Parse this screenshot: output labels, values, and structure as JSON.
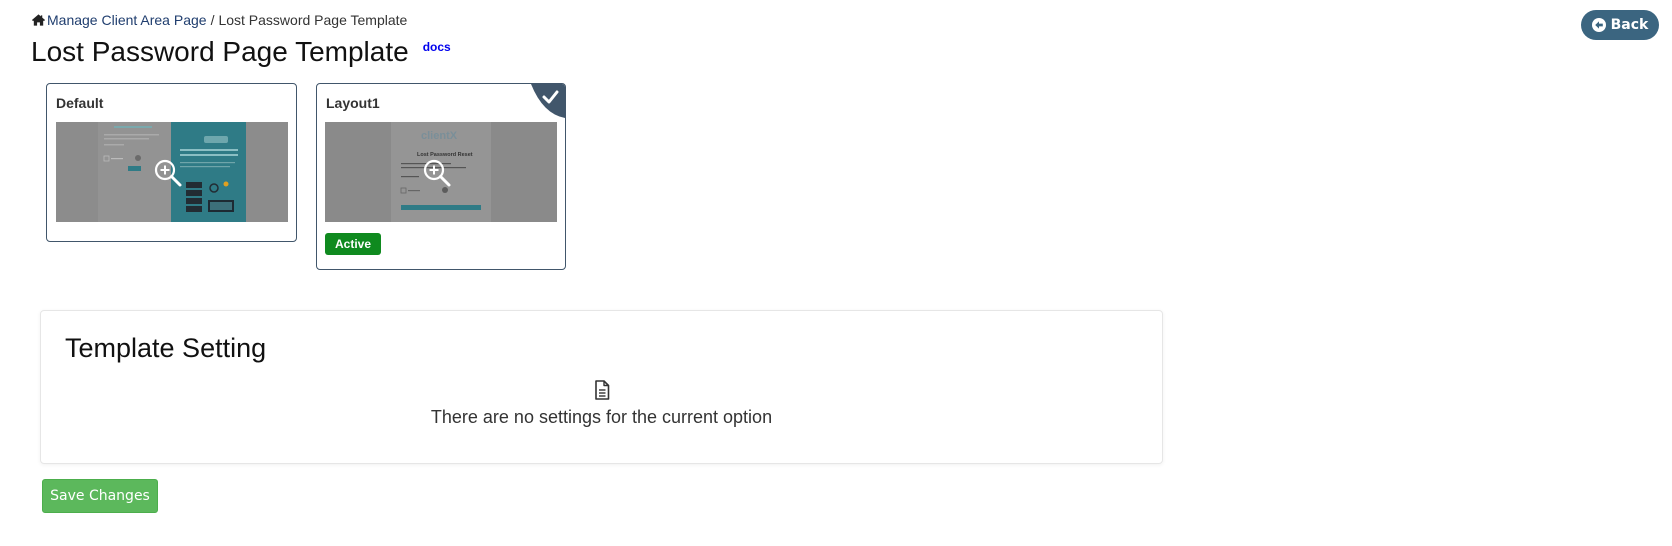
{
  "breadcrumb": {
    "home_icon": "home-icon",
    "parent_label": "Manage Client Area Page",
    "separator": "/",
    "current_label": "Lost Password Page Template"
  },
  "header": {
    "title": "Lost Password Page Template",
    "docs_label": "docs",
    "back_label": "Back",
    "back_icon": "arrow-circle-left-icon"
  },
  "templates": [
    {
      "name": "Default",
      "selected": false,
      "thumbnail_icon": "zoom-in-icon"
    },
    {
      "name": "Layout1",
      "selected": true,
      "status_label": "Active",
      "thumbnail_icon": "zoom-in-icon",
      "thumb_logo_text": "clientX",
      "thumb_heading_text": "Lost Password Reset"
    }
  ],
  "settings": {
    "title": "Template Setting",
    "empty_icon": "file-text-icon",
    "empty_message": "There are no settings for the current option"
  },
  "actions": {
    "save_label": "Save Changes"
  },
  "colors": {
    "accent": "#3b6580",
    "active_badge": "#0f8a1f",
    "save_button": "#5cb85c",
    "card_border": "#41566b"
  }
}
